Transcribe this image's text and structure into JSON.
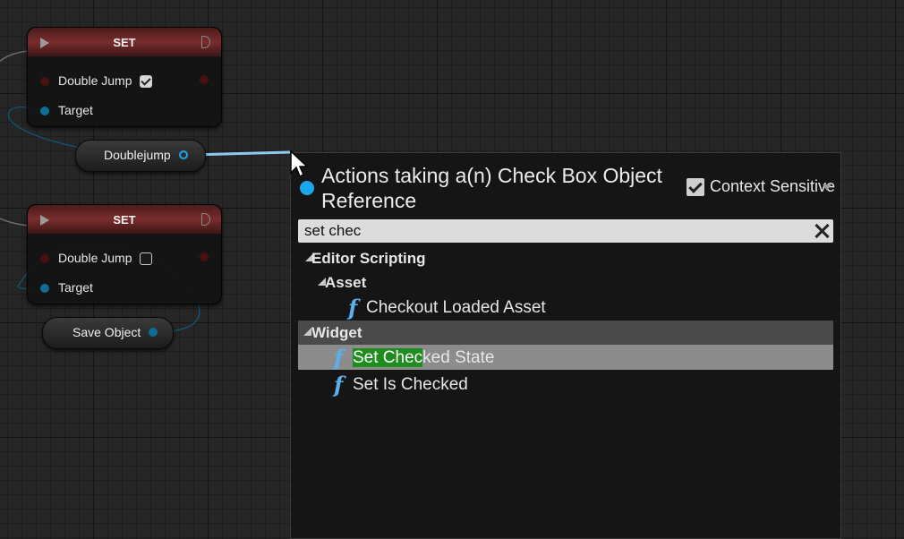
{
  "graph": {
    "set_node_1": {
      "title": "SET",
      "property_label": "Double Jump",
      "property_checked": true,
      "target_label": "Target"
    },
    "set_node_2": {
      "title": "SET",
      "property_label": "Double Jump",
      "property_checked": false,
      "target_label": "Target"
    },
    "doublejump_var": {
      "label": "Doublejump"
    },
    "save_object_var": {
      "label": "Save Object"
    }
  },
  "action_menu": {
    "title": "Actions taking a(n) Check Box Object Reference",
    "context_sensitive_label": "Context Sensitive",
    "context_sensitive_checked": true,
    "search_value": "set chec",
    "categories": [
      {
        "label": "Editor Scripting",
        "subcategories": [
          {
            "label": "Asset",
            "items": [
              "Checkout Loaded Asset"
            ]
          }
        ]
      },
      {
        "label": "Widget",
        "items": [
          {
            "label_match": "Set Chec",
            "label_rest": "ked State",
            "selected": true
          },
          {
            "label": "Set Is Checked",
            "selected": false
          }
        ]
      }
    ],
    "function_icon": "function-f-icon"
  },
  "colors": {
    "object_pin": "#1aa7ee",
    "set_header": "#7a2c2c",
    "function_icon": "#5aaff0",
    "search_highlight": "#1e8c1e",
    "selected_row": "#8c8c8c"
  }
}
